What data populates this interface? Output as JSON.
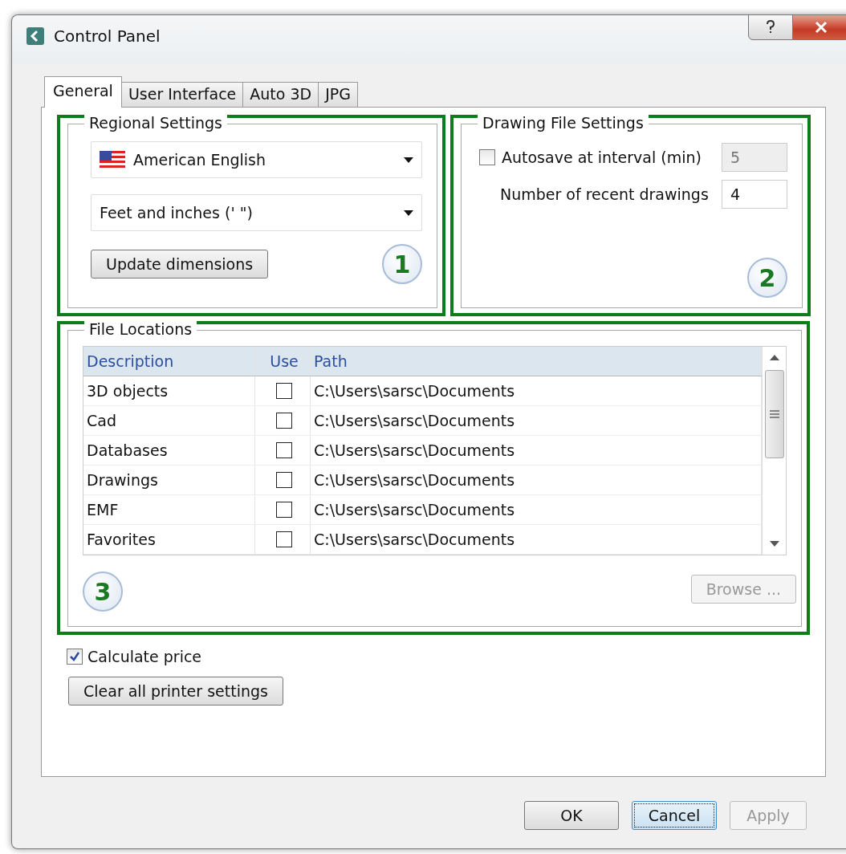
{
  "window": {
    "title": "Control Panel"
  },
  "tabs": [
    {
      "label": "General",
      "selected": true
    },
    {
      "label": "User Interface",
      "selected": false
    },
    {
      "label": "Auto 3D",
      "selected": false
    },
    {
      "label": "JPG",
      "selected": false
    }
  ],
  "regional_settings": {
    "title": "Regional Settings",
    "language": {
      "value": "American English"
    },
    "units": {
      "value": "Feet and inches (' \")"
    },
    "update_button": "Update dimensions",
    "callout": "1"
  },
  "drawing_file_settings": {
    "title": "Drawing File Settings",
    "autosave": {
      "label": "Autosave at interval (min)",
      "checked": false,
      "value": "5",
      "disabled": true
    },
    "recent": {
      "label": "Number of recent drawings",
      "value": "4"
    },
    "callout": "2"
  },
  "file_locations": {
    "title": "File Locations",
    "columns": [
      "Description",
      "Use",
      "Path"
    ],
    "rows": [
      {
        "description": "3D objects",
        "use": false,
        "path": "C:\\Users\\sarsc\\Documents"
      },
      {
        "description": "Cad",
        "use": false,
        "path": "C:\\Users\\sarsc\\Documents"
      },
      {
        "description": "Databases",
        "use": false,
        "path": "C:\\Users\\sarsc\\Documents"
      },
      {
        "description": "Drawings",
        "use": false,
        "path": "C:\\Users\\sarsc\\Documents"
      },
      {
        "description": "EMF",
        "use": false,
        "path": "C:\\Users\\sarsc\\Documents"
      },
      {
        "description": "Favorites",
        "use": false,
        "path": "C:\\Users\\sarsc\\Documents"
      }
    ],
    "browse_button": {
      "label": "Browse ...",
      "disabled": true
    },
    "callout": "3"
  },
  "calculate_price": {
    "label": "Calculate price",
    "checked": true
  },
  "clear_button": "Clear all printer settings",
  "footer_buttons": [
    {
      "label": "OK",
      "focused": false,
      "disabled": false
    },
    {
      "label": "Cancel",
      "focused": true,
      "disabled": false
    },
    {
      "label": "Apply",
      "focused": false,
      "disabled": true
    }
  ]
}
